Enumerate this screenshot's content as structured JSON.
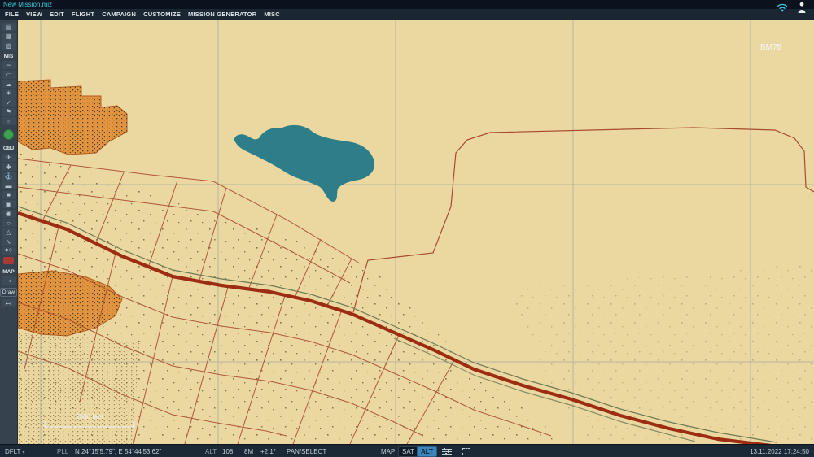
{
  "titlebar": {
    "title": "New Mission.miz",
    "icons": [
      {
        "name": "wifi-icon"
      },
      {
        "name": "user-icon"
      }
    ]
  },
  "menu": {
    "items": [
      {
        "label": "FILE",
        "name": "menu-file"
      },
      {
        "label": "VIEW",
        "name": "menu-view"
      },
      {
        "label": "EDIT",
        "name": "menu-edit"
      },
      {
        "label": "FLIGHT",
        "name": "menu-flight"
      },
      {
        "label": "CAMPAIGN",
        "name": "menu-campaign"
      },
      {
        "label": "CUSTOMIZE",
        "name": "menu-customize"
      },
      {
        "label": "MISSION GENERATOR",
        "name": "menu-mission-generator"
      },
      {
        "label": "MISC",
        "name": "menu-misc"
      }
    ]
  },
  "sidebar": {
    "top_icons": [
      {
        "name": "open-folder-icon",
        "glyph": "▤"
      },
      {
        "name": "save-icon",
        "glyph": "▦"
      },
      {
        "name": "briefcase-icon",
        "glyph": "▨"
      }
    ],
    "mis_label": "MIS",
    "mis_icons": [
      {
        "name": "mission-options-icon",
        "glyph": "☰"
      },
      {
        "name": "briefing-icon",
        "glyph": "▭"
      },
      {
        "name": "weather-icon",
        "glyph": "☁"
      },
      {
        "name": "time-icon",
        "glyph": "☀"
      },
      {
        "name": "goals-icon",
        "glyph": "✓"
      },
      {
        "name": "flag-icon",
        "glyph": "⚑"
      },
      {
        "name": "summary-icon",
        "glyph": "▫"
      }
    ],
    "obj_label": "OBJ",
    "obj_icons": [
      {
        "name": "airplane-group-icon",
        "glyph": "✈"
      },
      {
        "name": "helicopter-group-icon",
        "glyph": "✚"
      },
      {
        "name": "ship-group-icon",
        "glyph": "⚓"
      },
      {
        "name": "vehicle-group-icon",
        "glyph": "▬"
      },
      {
        "name": "static-object-icon",
        "glyph": "■"
      },
      {
        "name": "template-icon",
        "glyph": "▣"
      },
      {
        "name": "farp-icon",
        "glyph": "◉"
      },
      {
        "name": "trigger-zone-icon",
        "glyph": "○"
      },
      {
        "name": "sealane-icon",
        "glyph": "△"
      },
      {
        "name": "route-icon",
        "glyph": "∿"
      },
      {
        "name": "markers-icon",
        "glyph": "◆◇"
      }
    ],
    "map_label": "MAP",
    "key_icon_glyph": "⊸",
    "draw_label": "Draw",
    "measure_icon_glyph": "⊷"
  },
  "map": {
    "grid_label": "BM78",
    "scale_label": "2000 feet",
    "colors": {
      "terrain": "#ebd8a0",
      "urban": "#e2953e",
      "urban_border": "#b25a1f",
      "lake": "#2e7e8a",
      "road_major": "#9c2c12",
      "parcel": "#a84a2e",
      "grid": "#84919f",
      "secondary_road": "#6e7a52"
    }
  },
  "statusbar": {
    "profile": "DFLT",
    "profile_chevron": "▾",
    "pll_label": "PLL",
    "coordinates": "N 24°15'5.79\", E 54°44'53.62\"",
    "alt_label": "ALT",
    "alt_value": "108",
    "scale_value": "8M",
    "heading_value": "+2.1°",
    "mode": "PAN/SELECT",
    "map_button": "MAP",
    "sat_button": "SAT",
    "alt_button": "ALT",
    "datetime": "13.11.2022 17:24:50"
  }
}
